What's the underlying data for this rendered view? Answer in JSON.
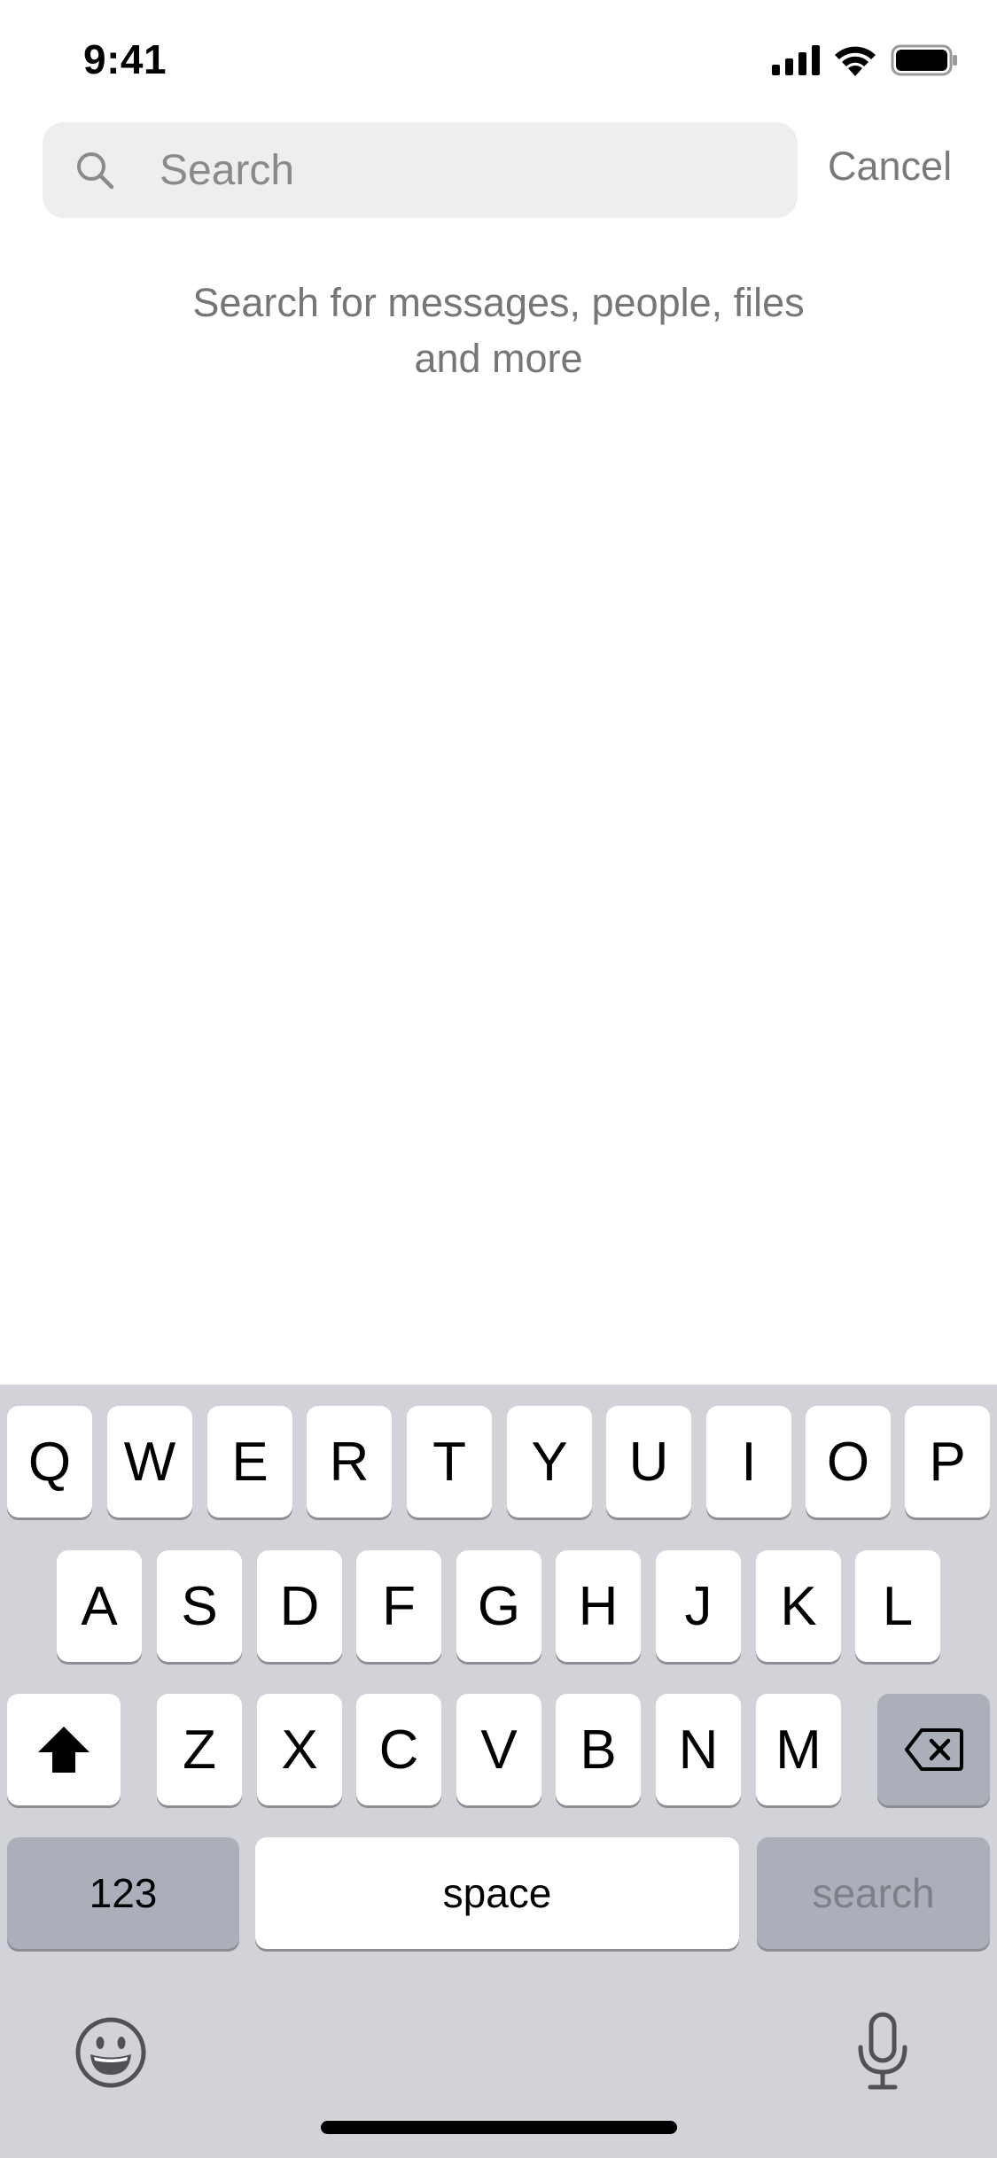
{
  "status_bar": {
    "time": "9:41",
    "icons": [
      "cellular-signal-icon",
      "wifi-icon",
      "battery-icon"
    ]
  },
  "search": {
    "placeholder": "Search",
    "value": "",
    "icon": "search-icon",
    "cancel_label": "Cancel"
  },
  "empty_state": {
    "line1": "Search for messages, people, files",
    "line2": "and more"
  },
  "keyboard": {
    "row1": [
      "Q",
      "W",
      "E",
      "R",
      "T",
      "Y",
      "U",
      "I",
      "O",
      "P"
    ],
    "row2": [
      "A",
      "S",
      "D",
      "F",
      "G",
      "H",
      "J",
      "K",
      "L"
    ],
    "row3": [
      "Z",
      "X",
      "C",
      "V",
      "B",
      "N",
      "M"
    ],
    "shift_icon": "shift-icon",
    "backspace_icon": "backspace-icon",
    "numbers_label": "123",
    "space_label": "space",
    "search_label": "search",
    "emoji_icon": "emoji-icon",
    "mic_icon": "microphone-icon"
  },
  "colors": {
    "keyboard_background": "#d2d3d8",
    "key_background": "#ffffff",
    "dark_key_background": "#abafba",
    "search_field_background": "#eeeeee",
    "secondary_text": "#76767a"
  }
}
